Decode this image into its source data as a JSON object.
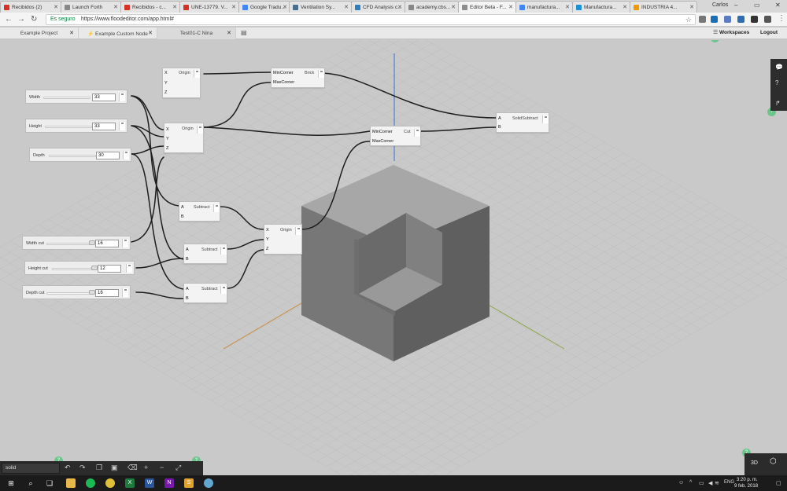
{
  "browser": {
    "user": "Carlos",
    "tabs": [
      {
        "label": "Recibidos (2)",
        "favicon": "gmail-icon",
        "color": "#d93025"
      },
      {
        "label": "Launch Forth",
        "favicon": "page-icon",
        "color": "#888888"
      },
      {
        "label": "Recibidos - c...",
        "favicon": "gmail-icon",
        "color": "#d93025"
      },
      {
        "label": "UNE-13779. V...",
        "favicon": "pdf-icon",
        "color": "#d93025"
      },
      {
        "label": "Google Tradu...",
        "favicon": "translate-icon",
        "color": "#4285f4"
      },
      {
        "label": "Ventilation Sy...",
        "favicon": "page-icon",
        "color": "#4a6d8c"
      },
      {
        "label": "CFD Analysis c...",
        "favicon": "page-icon",
        "color": "#2f7ebf"
      },
      {
        "label": "academy.cbs...",
        "favicon": "page-icon",
        "color": "#888888"
      },
      {
        "label": "Editor Beta - F...",
        "favicon": "page-icon",
        "color": "#8d8d8d"
      },
      {
        "label": "manufactura...",
        "favicon": "google-icon",
        "color": "#4285f4"
      },
      {
        "label": "Manufactura...",
        "favicon": "cloud-icon",
        "color": "#1d8fd6"
      },
      {
        "label": "INDUSTRIA 4...",
        "favicon": "info-icon",
        "color": "#f29900"
      }
    ],
    "secure_label": "Es seguro",
    "url": "https://www.floodeditor.com/app.html#"
  },
  "app": {
    "tabs": [
      "Example Project",
      "Example Custom Node",
      "Test01-C Nina"
    ],
    "workspaces_label": "Workspaces",
    "logout_label": "Logout"
  },
  "nodes": {
    "origin1": {
      "title": "Origin",
      "ports": [
        "X",
        "Y",
        "Z"
      ]
    },
    "brick": {
      "title": "Brick",
      "ports": [
        "MinCorner",
        "MaxCorner"
      ]
    },
    "origin2": {
      "title": "Origin",
      "ports": [
        "X",
        "Y",
        "Z"
      ]
    },
    "cut": {
      "title": "Cut",
      "ports": [
        "MinCorner",
        "MaxCorner"
      ]
    },
    "solidsubtract": {
      "title": "SolidSubtract",
      "ports": [
        "A",
        "B"
      ]
    },
    "subtract1": {
      "title": "Subtract",
      "ports": [
        "A",
        "B"
      ]
    },
    "subtract2": {
      "title": "Subtract",
      "ports": [
        "A",
        "B"
      ]
    },
    "subtract3": {
      "title": "Subtract",
      "ports": [
        "A",
        "B"
      ]
    },
    "origin3": {
      "title": "Origin",
      "ports": [
        "X",
        "Y",
        "Z"
      ]
    }
  },
  "sliders": [
    {
      "label": "Width",
      "value": "33"
    },
    {
      "label": "Height",
      "value": "33"
    },
    {
      "label": "Depth",
      "value": "30"
    },
    {
      "label": "Width cut",
      "value": "16"
    },
    {
      "label": "Height cut",
      "value": "12"
    },
    {
      "label": "Depth cut",
      "value": "16"
    }
  ],
  "bottom": {
    "search_value": "solid",
    "view_label": "3D"
  },
  "taskbar": {
    "lang": "ENG",
    "time": "3:20 p. m.",
    "date": "9 feb. 2018"
  },
  "colors": {
    "help_dot": "#6bc58d",
    "axis_blue": "#3b6fd6",
    "axis_orange": "#c98a3a",
    "axis_green": "#8aa74a"
  }
}
